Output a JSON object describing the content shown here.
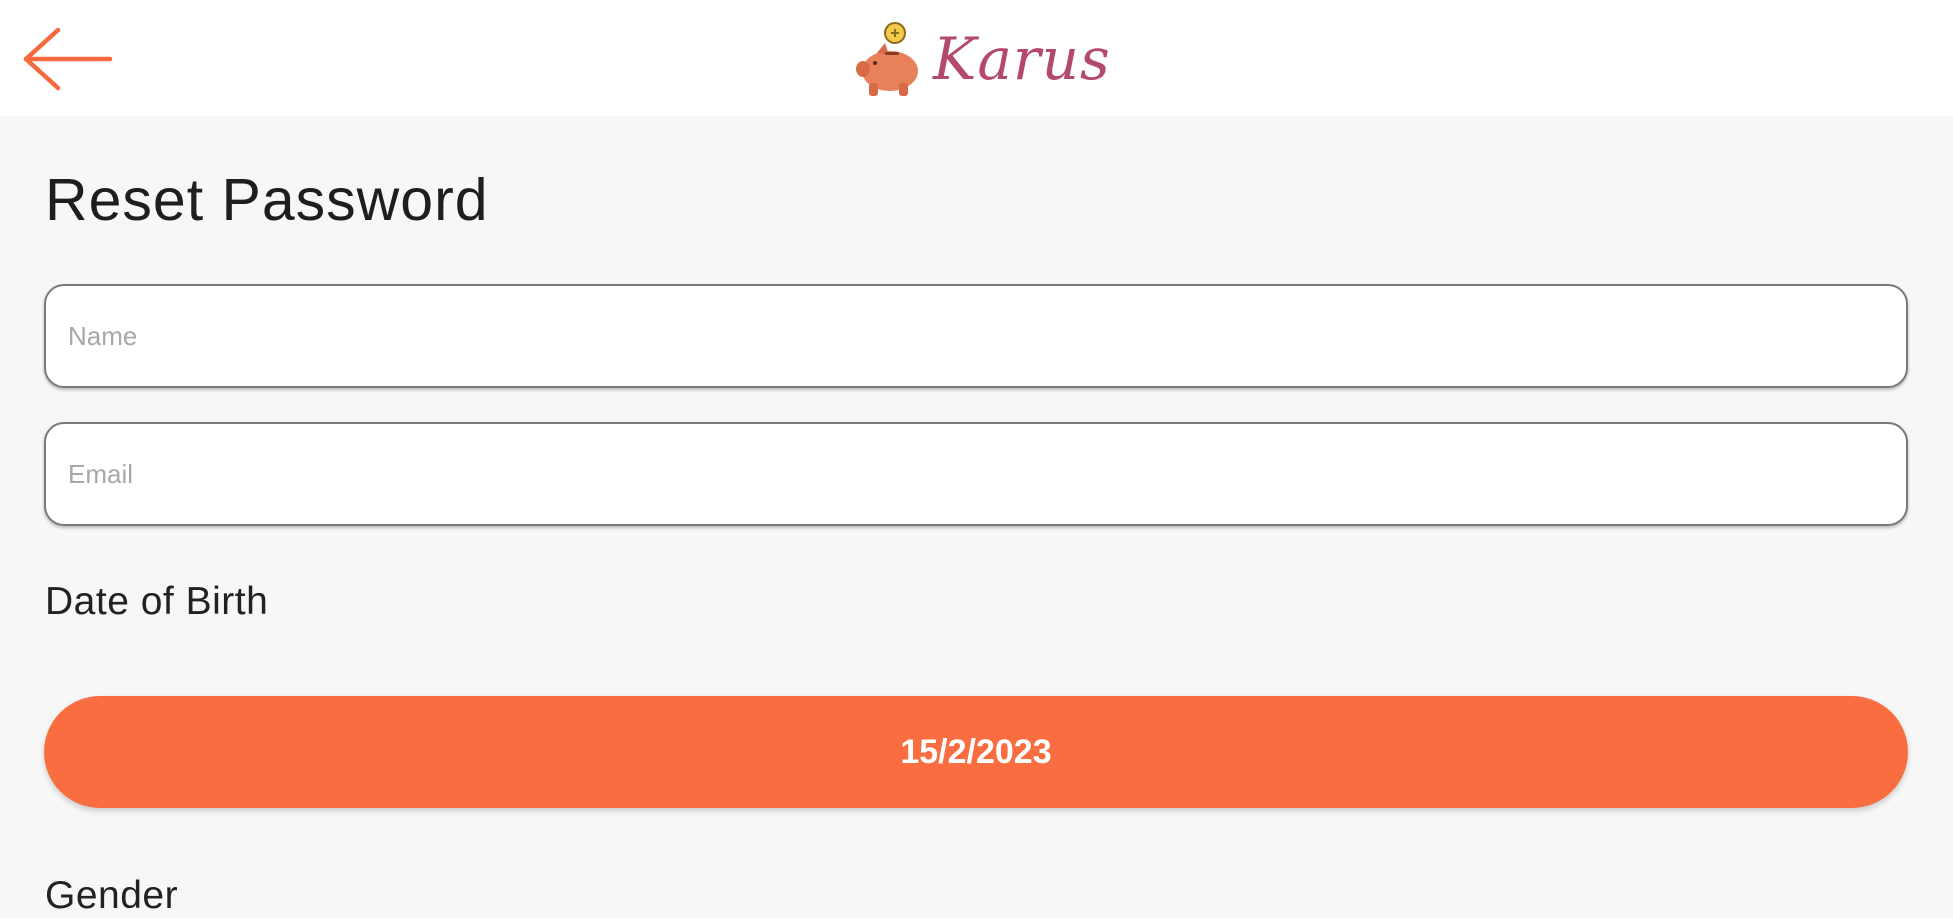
{
  "header": {
    "back_icon": "arrow-left-icon",
    "logo_icon": "piggy-bank-icon",
    "logo_text": "Karus"
  },
  "form": {
    "title": "Reset Password",
    "name_placeholder": "Name",
    "email_placeholder": "Email",
    "dob_label": "Date of Birth",
    "dob_value": "15/2/2023",
    "gender_label": "Gender"
  },
  "colors": {
    "accent": "#fa6d40",
    "back_arrow": "#f26a3d",
    "logo_text": "#b34a6e",
    "pig": "#e8805a",
    "coin": "#f2c94c",
    "background": "#f7f7f7"
  }
}
